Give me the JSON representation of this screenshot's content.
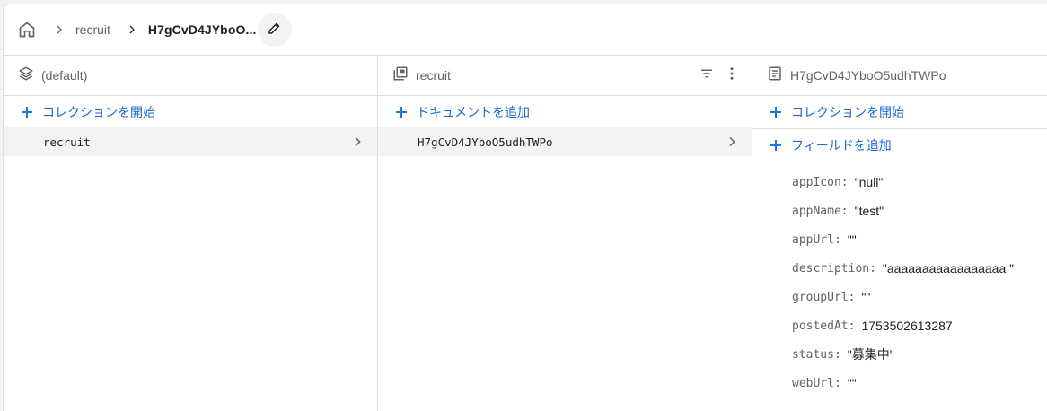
{
  "breadcrumb": {
    "home_icon": "home-icon",
    "items": [
      "recruit",
      "H7gCvD4JYboO..."
    ],
    "edit_icon": "pencil-icon"
  },
  "panels": {
    "root": {
      "title": "(default)",
      "icon": "layers-icon",
      "action_label": "コレクションを開始",
      "items": [
        {
          "label": "recruit",
          "selected": true
        }
      ]
    },
    "collection": {
      "title": "recruit",
      "icon": "collection-icon",
      "action_label": "ドキュメントを追加",
      "items": [
        {
          "label": "H7gCvD4JYboO5udhTWPo",
          "selected": true
        }
      ]
    },
    "document": {
      "title": "H7gCvD4JYboO5udhTWPo",
      "icon": "document-icon",
      "action_start_collection": "コレクションを開始",
      "action_add_field": "フィールドを追加",
      "fields": [
        {
          "key": "appIcon",
          "value": "\"null\""
        },
        {
          "key": "appName",
          "value": "\"test\""
        },
        {
          "key": "appUrl",
          "value": "\"\""
        },
        {
          "key": "description",
          "value": "\"aaaaaaaaaaaaaaaaa \""
        },
        {
          "key": "groupUrl",
          "value": "\"\""
        },
        {
          "key": "postedAt",
          "value": "1753502613287"
        },
        {
          "key": "status",
          "value": "\"募集中\""
        },
        {
          "key": "webUrl",
          "value": "\"\""
        }
      ]
    }
  },
  "colors": {
    "accent": "#1a73e8",
    "selected_bg": "#f1f3f4",
    "border": "#dadce0"
  }
}
